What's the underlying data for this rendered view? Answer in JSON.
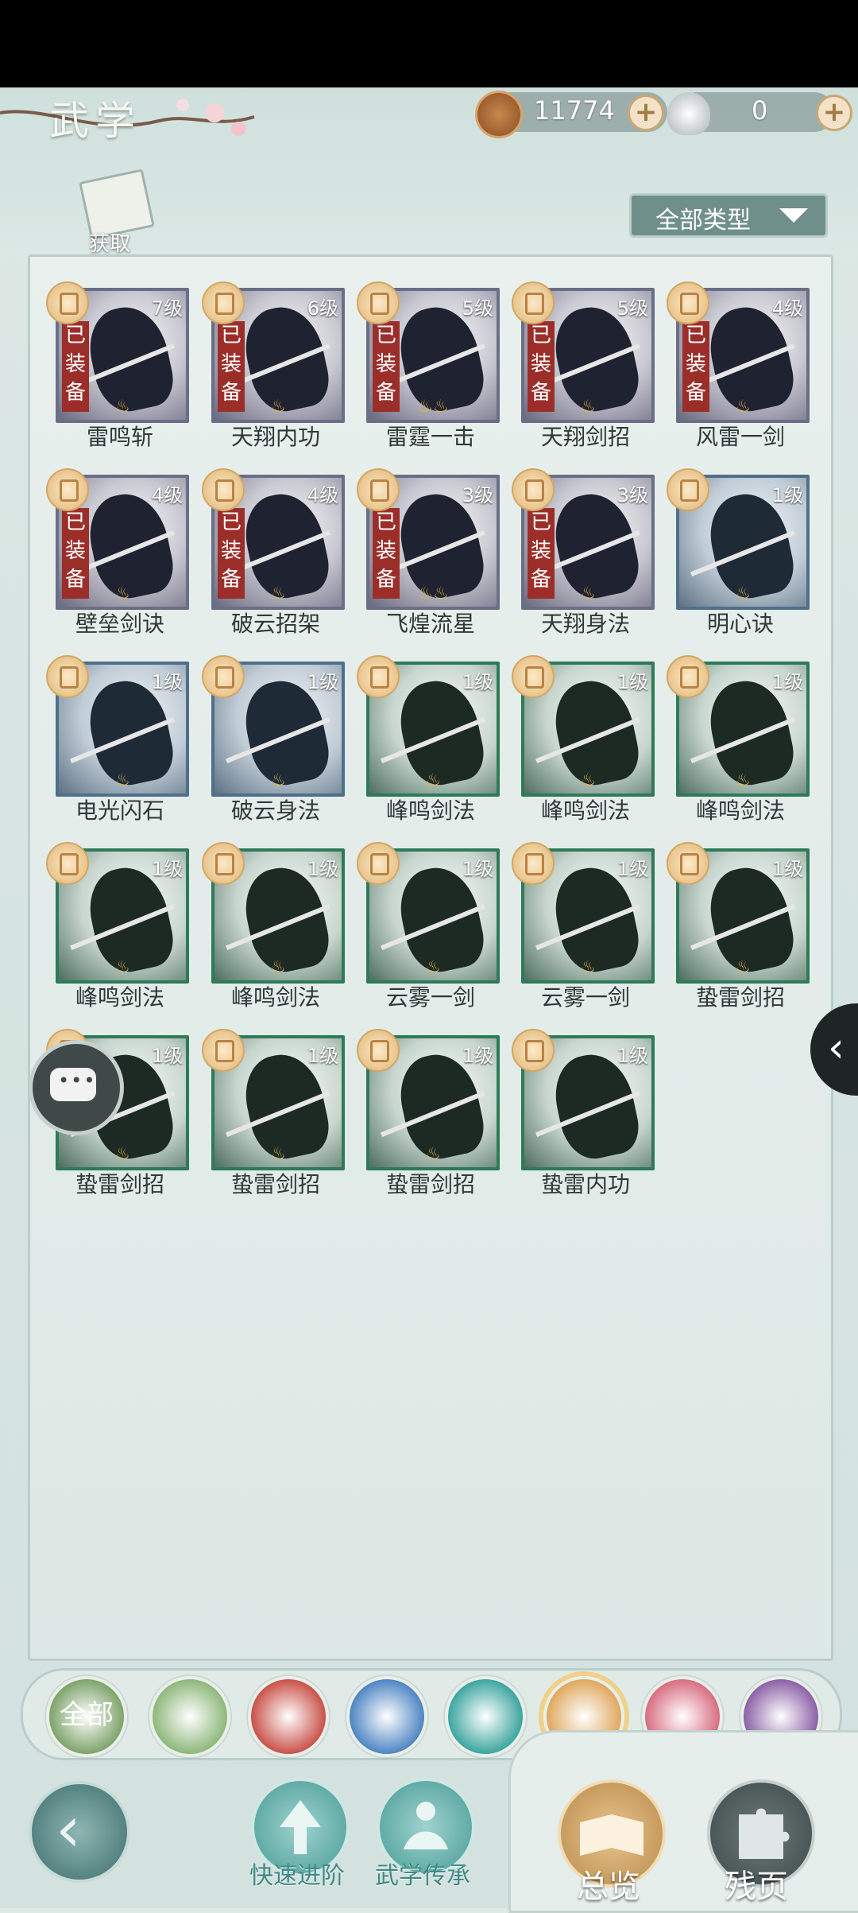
{
  "header": {
    "title": "武学",
    "coins": "11774",
    "silver": "0",
    "acquire_label": "获取",
    "filter_label": "全部类型"
  },
  "skills": [
    {
      "name": "雷鸣斩",
      "level": "7级",
      "equipped": "已装备",
      "frame": "purple",
      "drops": "1"
    },
    {
      "name": "天翔内功",
      "level": "6级",
      "equipped": "已装备",
      "frame": "purple",
      "drops": "1"
    },
    {
      "name": "雷霆一击",
      "level": "5级",
      "equipped": "已装备",
      "frame": "purple",
      "drops": "2"
    },
    {
      "name": "天翔剑招",
      "level": "5级",
      "equipped": "已装备",
      "frame": "purple",
      "drops": "1"
    },
    {
      "name": "风雷一剑",
      "level": "4级",
      "equipped": "已装备",
      "frame": "purple",
      "drops": "1"
    },
    {
      "name": "壁垒剑诀",
      "level": "4级",
      "equipped": "已装备",
      "frame": "purple",
      "drops": "1"
    },
    {
      "name": "破云招架",
      "level": "4级",
      "equipped": "已装备",
      "frame": "purple",
      "drops": "1"
    },
    {
      "name": "飞煌流星",
      "level": "3级",
      "equipped": "已装备",
      "frame": "purple",
      "drops": "2"
    },
    {
      "name": "天翔身法",
      "level": "3级",
      "equipped": "已装备",
      "frame": "purple",
      "drops": "1"
    },
    {
      "name": "明心诀",
      "level": "1级",
      "equipped": "",
      "frame": "blue",
      "drops": "1"
    },
    {
      "name": "电光闪石",
      "level": "1级",
      "equipped": "",
      "frame": "blue",
      "drops": "1"
    },
    {
      "name": "破云身法",
      "level": "1级",
      "equipped": "",
      "frame": "blue",
      "drops": "1"
    },
    {
      "name": "峰鸣剑法",
      "level": "1级",
      "equipped": "",
      "frame": "green",
      "drops": "1"
    },
    {
      "name": "峰鸣剑法",
      "level": "1级",
      "equipped": "",
      "frame": "green",
      "drops": "1"
    },
    {
      "name": "峰鸣剑法",
      "level": "1级",
      "equipped": "",
      "frame": "green",
      "drops": "1"
    },
    {
      "name": "峰鸣剑法",
      "level": "1级",
      "equipped": "",
      "frame": "green",
      "drops": "1"
    },
    {
      "name": "峰鸣剑法",
      "level": "1级",
      "equipped": "",
      "frame": "green",
      "drops": "1"
    },
    {
      "name": "云雾一剑",
      "level": "1级",
      "equipped": "",
      "frame": "green",
      "drops": "1"
    },
    {
      "name": "云雾一剑",
      "level": "1级",
      "equipped": "",
      "frame": "green",
      "drops": "1"
    },
    {
      "name": "蛰雷剑招",
      "level": "1级",
      "equipped": "",
      "frame": "green",
      "drops": "1"
    },
    {
      "name": "蛰雷剑招",
      "level": "1级",
      "equipped": "",
      "frame": "green",
      "drops": "1"
    },
    {
      "name": "蛰雷剑招",
      "level": "1级",
      "equipped": "",
      "frame": "green",
      "drops": "1"
    },
    {
      "name": "蛰雷剑招",
      "level": "1级",
      "equipped": "",
      "frame": "green",
      "drops": "1"
    },
    {
      "name": "蛰雷内功",
      "level": "1级",
      "equipped": "",
      "frame": "green",
      "drops": ""
    }
  ],
  "categories": [
    {
      "label": "全部",
      "color": "#7fa46c",
      "icon": "all-category-icon",
      "active": false
    },
    {
      "label": "",
      "color": "#8fb87c",
      "icon": "blade-category-icon",
      "active": false
    },
    {
      "label": "",
      "color": "#c9534a",
      "icon": "flame-category-icon",
      "active": false
    },
    {
      "label": "",
      "color": "#4f86c4",
      "icon": "wave-category-icon",
      "active": false
    },
    {
      "label": "",
      "color": "#3ea6a0",
      "icon": "butterfly-category-icon",
      "active": false
    },
    {
      "label": "",
      "color": "#e0a95f",
      "icon": "shield-category-icon",
      "active": true
    },
    {
      "label": "",
      "color": "#d86f82",
      "icon": "moon-category-icon",
      "active": false
    },
    {
      "label": "",
      "color": "#8d62a8",
      "icon": "rose-category-icon",
      "active": false
    }
  ],
  "bottom": {
    "quick_advance": "快速进阶",
    "inherit": "武学传承",
    "overview": "总览",
    "fragments": "残页"
  },
  "colors": {
    "equipped_tag": "#9c2e2a",
    "accent_gold": "#e0b24a"
  }
}
